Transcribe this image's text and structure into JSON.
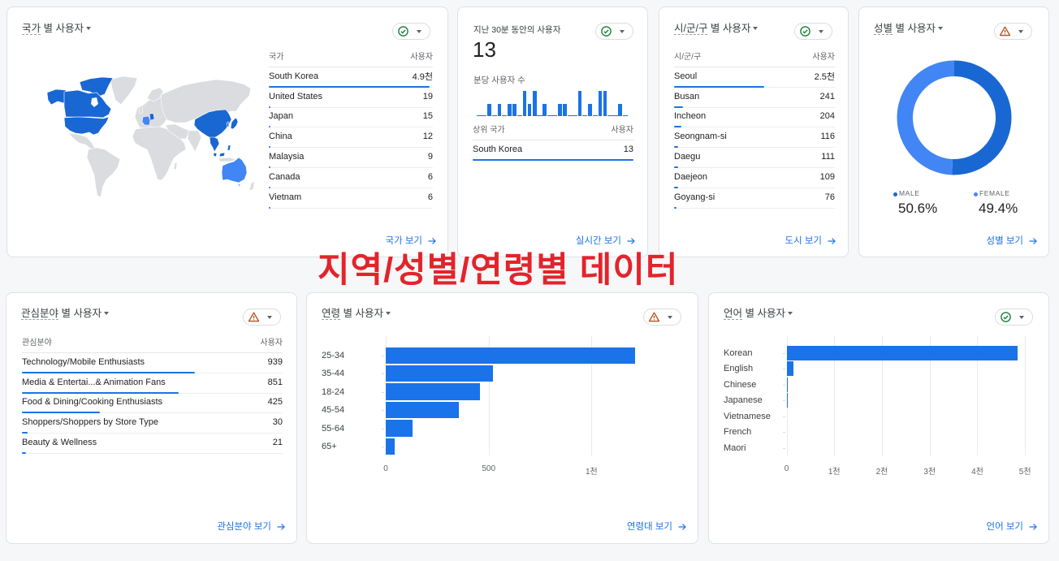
{
  "overlay_title": "지역/성별/연령별 데이터",
  "colors": {
    "accent": "#1a73e8",
    "map_high": "#1967d2",
    "map_mid": "#4285f4",
    "map_none": "#dadce0",
    "gender_male": "#1967d2",
    "gender_female": "#4285f4",
    "status_ok": "#188038",
    "status_warning": "#b3541e",
    "overlay": "#e3242b"
  },
  "cards": {
    "country": {
      "title_dim": "국가",
      "title_suffix": " 별 사용자",
      "status_icon": "check-circle-icon",
      "table": {
        "col1": "국가",
        "col2": "사용자",
        "rows": [
          {
            "label": "South Korea",
            "value": "4.9천",
            "bar_fraction": 0.98
          },
          {
            "label": "United States",
            "value": "19",
            "bar_fraction": 0.004
          },
          {
            "label": "Japan",
            "value": "15",
            "bar_fraction": 0.003
          },
          {
            "label": "China",
            "value": "12",
            "bar_fraction": 0.0025
          },
          {
            "label": "Malaysia",
            "value": "9",
            "bar_fraction": 0.002
          },
          {
            "label": "Canada",
            "value": "6",
            "bar_fraction": 0.001
          },
          {
            "label": "Vietnam",
            "value": "6",
            "bar_fraction": 0.001
          }
        ]
      },
      "link": "국가 보기"
    },
    "realtime": {
      "label": "지난 30분 동안의 사용자",
      "count": "13",
      "chart_label": "분당 사용자 수",
      "status_icon": "check-circle-icon",
      "table": {
        "col1": "상위 국가",
        "col2": "사용자",
        "rows": [
          {
            "label": "South Korea",
            "value": "13",
            "bar_fraction": 1.0
          }
        ]
      },
      "link": "실시간 보기"
    },
    "city": {
      "title_dim": "시/군/구",
      "title_suffix": " 별 사용자",
      "status_icon": "check-circle-icon",
      "table": {
        "col1": "시/군/구",
        "col2": "사용자",
        "rows": [
          {
            "label": "Seoul",
            "value": "2.5천",
            "bar_fraction": 0.56
          },
          {
            "label": "Busan",
            "value": "241",
            "bar_fraction": 0.054
          },
          {
            "label": "Incheon",
            "value": "204",
            "bar_fraction": 0.046
          },
          {
            "label": "Seongnam-si",
            "value": "116",
            "bar_fraction": 0.026
          },
          {
            "label": "Daegu",
            "value": "111",
            "bar_fraction": 0.025
          },
          {
            "label": "Daejeon",
            "value": "109",
            "bar_fraction": 0.024
          },
          {
            "label": "Goyang-si",
            "value": "76",
            "bar_fraction": 0.017
          }
        ]
      },
      "link": "도시 보기"
    },
    "gender": {
      "title_dim": "성별",
      "title_suffix": " 별 사용자",
      "status_icon": "warning-icon",
      "legend": [
        {
          "label": "MALE",
          "value": "50.6%"
        },
        {
          "label": "FEMALE",
          "value": "49.4%"
        }
      ],
      "link": "성별 보기"
    },
    "interest": {
      "title_dim": "관심분야",
      "title_suffix": " 별 사용자",
      "status_icon": "warning-icon",
      "table": {
        "col1": "관심분야",
        "col2": "사용자",
        "rows": [
          {
            "label": "Technology/Mobile Enthusiasts",
            "value": "939",
            "bar_fraction": 0.664
          },
          {
            "label": "Media & Entertai...& Animation Fans",
            "value": "851",
            "bar_fraction": 0.601
          },
          {
            "label": "Food & Dining/Cooking Enthusiasts",
            "value": "425",
            "bar_fraction": 0.3
          },
          {
            "label": "Shoppers/Shoppers by Store Type",
            "value": "30",
            "bar_fraction": 0.021
          },
          {
            "label": "Beauty & Wellness",
            "value": "21",
            "bar_fraction": 0.015
          }
        ]
      },
      "link": "관심분야 보기"
    },
    "age": {
      "title_dim": "연령",
      "title_suffix": " 별 사용자",
      "status_icon": "warning-icon",
      "link": "연령대 보기"
    },
    "language": {
      "title_dim": "언어",
      "title_suffix": " 별 사용자",
      "status_icon": "check-circle-icon",
      "link": "언어 보기"
    }
  },
  "chart_data": [
    {
      "id": "realtime_users_per_minute",
      "type": "bar",
      "title": "분당 사용자 수",
      "values": [
        0,
        0,
        1,
        0,
        1,
        0,
        1,
        1,
        0,
        2,
        1,
        2,
        0,
        1,
        0,
        0,
        1,
        1,
        0,
        0,
        2,
        0,
        1,
        0,
        2,
        2,
        0,
        0,
        1,
        0
      ],
      "ylim": [
        0,
        2
      ]
    },
    {
      "id": "gender",
      "type": "pie",
      "title": "성별 별 사용자",
      "categories": [
        "MALE",
        "FEMALE"
      ],
      "values": [
        50.6,
        49.4
      ]
    },
    {
      "id": "age",
      "type": "bar",
      "orientation": "horizontal",
      "title": "연령 별 사용자",
      "categories": [
        "25-34",
        "35-44",
        "18-24",
        "45-54",
        "55-64",
        "65+"
      ],
      "values": [
        1210,
        521,
        456,
        355,
        129,
        45
      ],
      "xticks": [
        0,
        500,
        1000
      ],
      "xtick_labels": [
        "0",
        "500",
        "1천"
      ],
      "xlim": [
        0,
        1300
      ],
      "grid": true
    },
    {
      "id": "language",
      "type": "bar",
      "orientation": "horizontal",
      "title": "언어 별 사용자",
      "categories": [
        "Korean",
        "English",
        "Chinese",
        "Japanese",
        "Vietnamese",
        "French",
        "Maori"
      ],
      "values": [
        4840,
        140,
        10,
        10,
        5,
        5,
        5
      ],
      "xticks": [
        0,
        1000,
        2000,
        3000,
        4000,
        5000
      ],
      "xtick_labels": [
        "0",
        "1천",
        "2천",
        "3천",
        "4천",
        "5천"
      ],
      "xlim": [
        0,
        5000
      ],
      "grid": true
    }
  ]
}
